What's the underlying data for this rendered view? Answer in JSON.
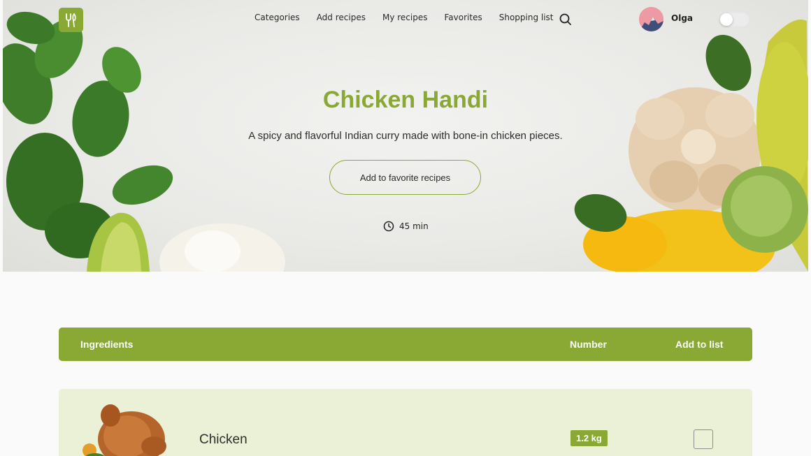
{
  "header": {
    "nav": [
      "Categories",
      "Add recipes",
      "My recipes",
      "Favorites",
      "Shopping list"
    ],
    "user": {
      "name": "Olga"
    },
    "icons": {
      "logo": "fork-spoon-icon",
      "search": "search-icon",
      "theme_toggle": "toggle-switch"
    }
  },
  "hero": {
    "title": "Chicken Handi",
    "description": "A spicy and flavorful Indian curry made with bone-in chicken pieces.",
    "favorite_button": "Add to favorite recipes",
    "time": "45 min",
    "time_icon": "clock-icon"
  },
  "ingredients": {
    "headers": {
      "name": "Ingredients",
      "number": "Number",
      "add": "Add to list"
    },
    "items": [
      {
        "name": "Chicken",
        "amount": "1.2 kg",
        "checked": false
      }
    ]
  },
  "colors": {
    "accent": "#8aa834",
    "row_bg": "#ebf1d6",
    "page_bg": "#fafafa"
  }
}
